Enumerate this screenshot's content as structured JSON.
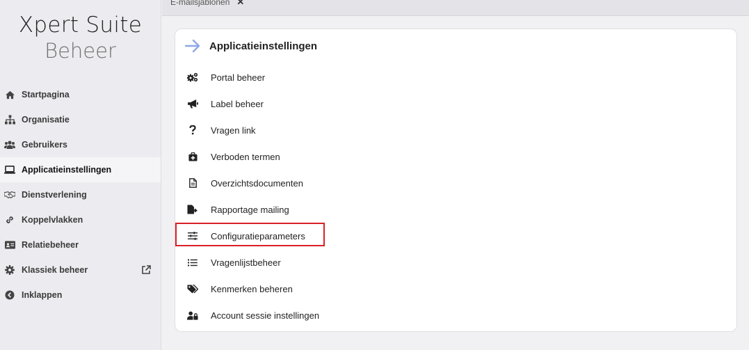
{
  "brand": {
    "line1": "Xpert Suite",
    "line2": "Beheer"
  },
  "tab": {
    "label": "E-mailsjablonen",
    "close": "✕"
  },
  "sidebar": {
    "items": [
      {
        "label": "Startpagina",
        "icon": "home-icon"
      },
      {
        "label": "Organisatie",
        "icon": "sitemap-icon"
      },
      {
        "label": "Gebruikers",
        "icon": "users-icon"
      },
      {
        "label": "Applicatieinstellingen",
        "icon": "laptop-icon",
        "active": true
      },
      {
        "label": "Dienstverlening",
        "icon": "handshake-icon"
      },
      {
        "label": "Koppelvlakken",
        "icon": "link-icon"
      },
      {
        "label": "Relatiebeheer",
        "icon": "id-card-icon"
      },
      {
        "label": "Klassiek beheer",
        "icon": "gear-icon",
        "external": true
      },
      {
        "label": "Inklappen",
        "icon": "chevron-left-circle-icon"
      }
    ]
  },
  "card": {
    "title": "Applicatieinstellingen",
    "items": [
      {
        "label": "Portal beheer",
        "icon": "cogs-icon"
      },
      {
        "label": "Label beheer",
        "icon": "megaphone-icon"
      },
      {
        "label": "Vragen link",
        "icon": "question-icon"
      },
      {
        "label": "Verboden termen",
        "icon": "medkit-icon"
      },
      {
        "label": "Overzichtsdocumenten",
        "icon": "document-icon"
      },
      {
        "label": "Rapportage mailing",
        "icon": "file-export-icon"
      },
      {
        "label": "Configuratieparameters",
        "icon": "sliders-icon",
        "highlighted": true
      },
      {
        "label": "Vragenlijstbeheer",
        "icon": "list-icon"
      },
      {
        "label": "Kenmerken beheren",
        "icon": "tags-icon"
      },
      {
        "label": "Account sessie instellingen",
        "icon": "user-lock-icon"
      }
    ]
  },
  "colors": {
    "accent_arrow": "#8fa8e6",
    "highlight_border": "#d91f26",
    "sidebar_bg": "#ececf0"
  }
}
